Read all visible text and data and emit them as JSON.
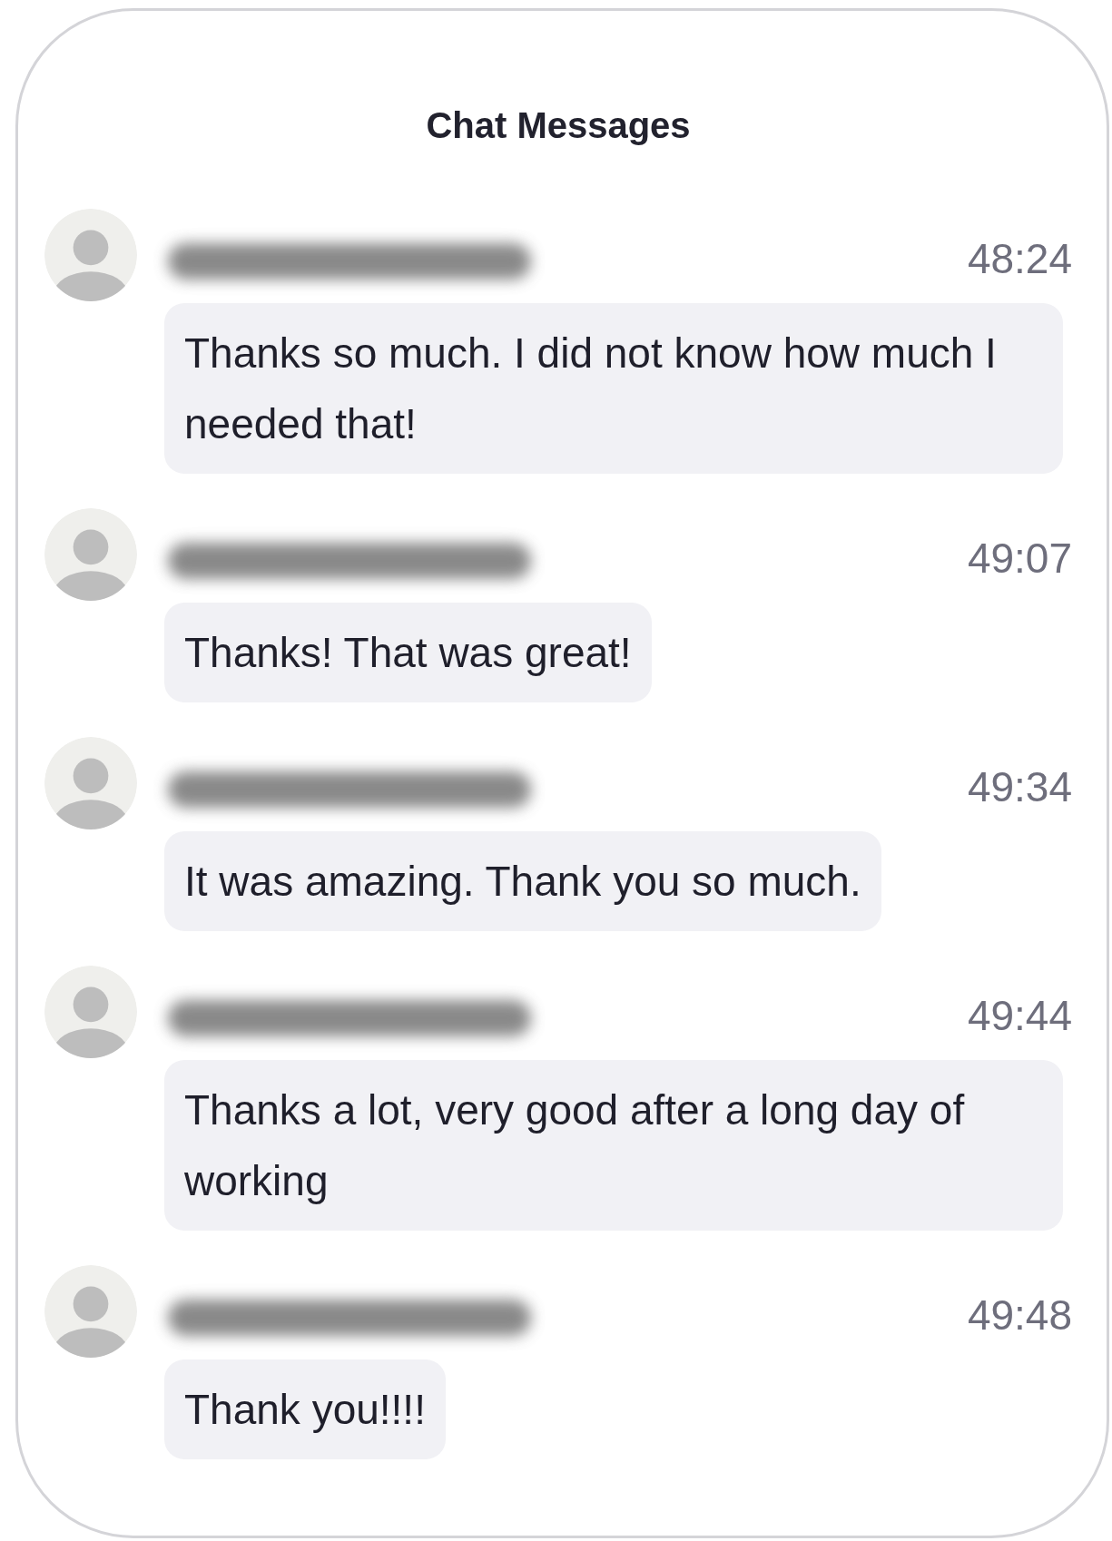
{
  "title": "Chat Messages",
  "messages": [
    {
      "time": "48:24",
      "text": "Thanks so much. I did not know how much I needed that!"
    },
    {
      "time": "49:07",
      "text": "Thanks! That was great!"
    },
    {
      "time": "49:34",
      "text": "It was amazing. Thank you so much."
    },
    {
      "time": "49:44",
      "text": "Thanks a lot, very good after a long day of working"
    },
    {
      "time": "49:48",
      "text": "Thank you!!!!"
    }
  ]
}
